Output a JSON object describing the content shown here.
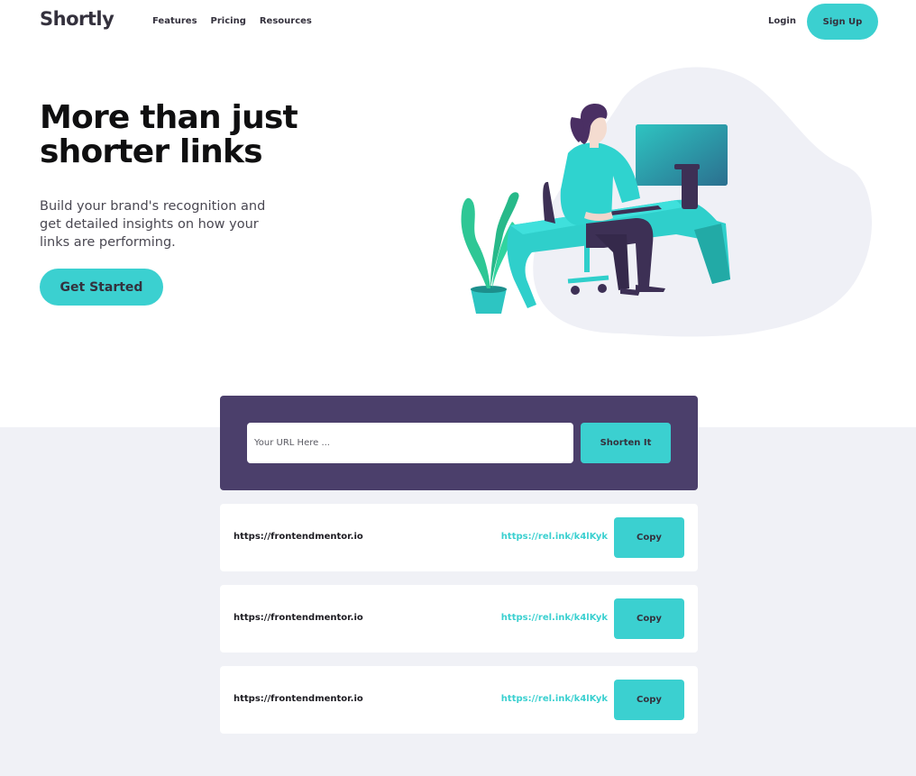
{
  "header": {
    "logo": "Shortly",
    "nav": [
      "Features",
      "Pricing",
      "Resources"
    ],
    "login": "Login",
    "signup": "Sign Up"
  },
  "hero": {
    "title": "More than just shorter links",
    "text": "Build your brand's recognition and get detailed insights on how your links are performing.",
    "cta": "Get Started"
  },
  "shorten": {
    "placeholder": "Your URL Here ...",
    "button": "Shorten It"
  },
  "results": [
    {
      "original": "https://frontendmentor.io",
      "short": "https://rel.ink/k4lKyk",
      "copy": "Copy"
    },
    {
      "original": "https://frontendmentor.io",
      "short": "https://rel.ink/k4lKyk",
      "copy": "Copy"
    },
    {
      "original": "https://frontendmentor.io",
      "short": "https://rel.ink/k4lKyk",
      "copy": "Copy"
    }
  ],
  "colors": {
    "accent": "#3bd0d0",
    "panel": "#4b3f6b",
    "text_dark": "#34313d",
    "background_gray": "#f0f1f6"
  },
  "icons": [
    "person-at-desk-illustration",
    "plant-illustration"
  ]
}
